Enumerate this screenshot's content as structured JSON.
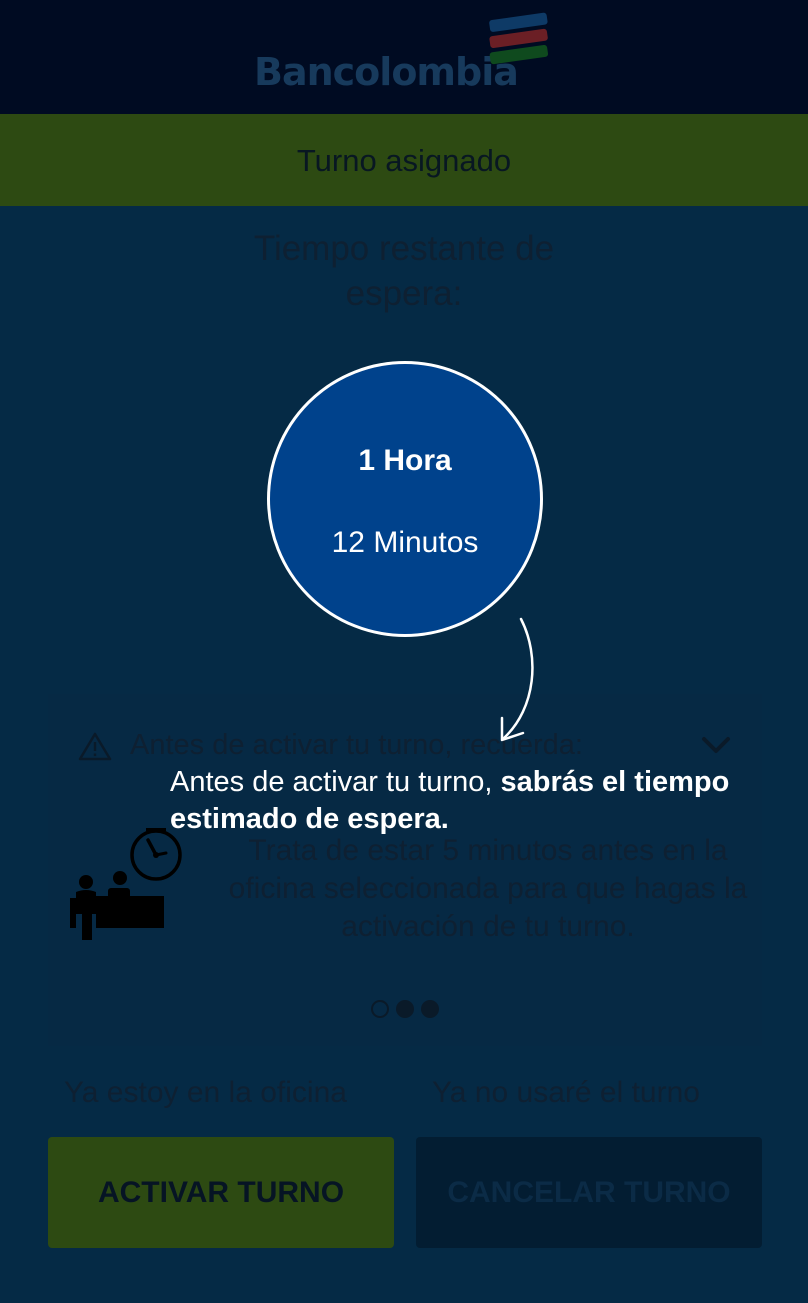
{
  "header": {
    "brand": "Bancolombia",
    "logo_colors": [
      "#0e3a66",
      "#6b1f25",
      "#0f4a1e"
    ]
  },
  "status": {
    "title": "Turno asignado"
  },
  "wait": {
    "title": "Tiempo restante de espera:",
    "hours": "1 Hora",
    "minutes": "12 Minutos"
  },
  "info_card": {
    "header": "Antes de activar tu turno, recuerda:",
    "body": "Trata de estar 5 minutos antes en la oficina seleccionada para que hagas la activación de tu turno.",
    "icons": [
      "warning-icon",
      "chevron-down-icon",
      "waiting-room-icon"
    ],
    "pager": {
      "count": 3,
      "active": 1
    }
  },
  "coach": {
    "text_normal": "Antes de activar tu turno, ",
    "text_bold": "sabrás el tiempo estimado de espera."
  },
  "actions": {
    "left_label": "Ya estoy en la oficina",
    "right_label": "Ya no usaré el turno",
    "activate": "ACTIVAR TURNO",
    "cancel": "CANCELAR TURNO"
  },
  "colors": {
    "overlay_bg": "#052a45",
    "header_bg": "#000b22",
    "accent_green": "#2d4a12",
    "timer_blue": "#00428c"
  }
}
